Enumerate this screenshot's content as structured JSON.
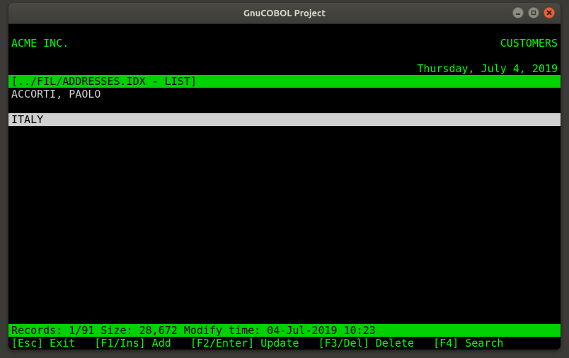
{
  "window": {
    "title": "GnuCOBOL Project"
  },
  "header": {
    "company": "ACME INC.",
    "module": "CUSTOMERS",
    "date": "Thursday, July 4, 2019"
  },
  "pathbar": "[../FIL/ADDRESSES.IDX - LIST]",
  "record": {
    "name": "ACCORTI, PAOLO",
    "country": "ITALY"
  },
  "status": "Records: 1/91 Size: 28,672 Modify time: 04-Jul-2019 10:23",
  "footer": {
    "esc": "[Esc] Exit",
    "f1": "[F1/Ins] Add",
    "f2": "[F2/Enter] Update",
    "f3": "[F3/Del] Delete",
    "f4": "[F4] Search"
  }
}
